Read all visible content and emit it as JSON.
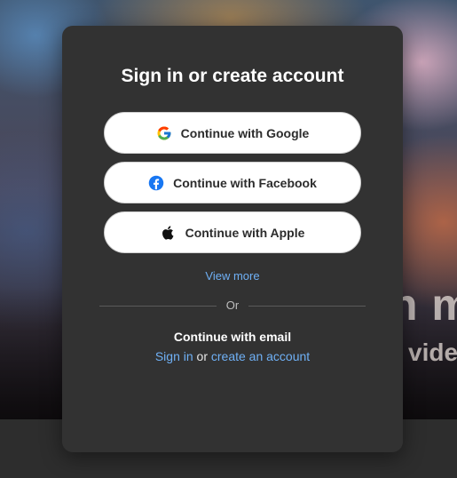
{
  "modal": {
    "title": "Sign in or create account",
    "buttons": {
      "google": {
        "label": "Continue with Google",
        "icon": "google-icon"
      },
      "facebook": {
        "label": "Continue with Facebook",
        "icon": "facebook-icon"
      },
      "apple": {
        "label": "Continue with Apple",
        "icon": "apple-icon"
      }
    },
    "view_more": "View more",
    "divider_text": "Or",
    "email_heading": "Continue with email",
    "sign_in_link": "Sign in",
    "or_text": "or",
    "create_account_link": "create an account"
  },
  "background": {
    "text_1": "n m",
    "text_2": "vide"
  },
  "colors": {
    "modal_bg": "#323232",
    "link": "#6fb0f5",
    "button_bg": "#ffffff",
    "facebook_blue": "#1877f2"
  }
}
